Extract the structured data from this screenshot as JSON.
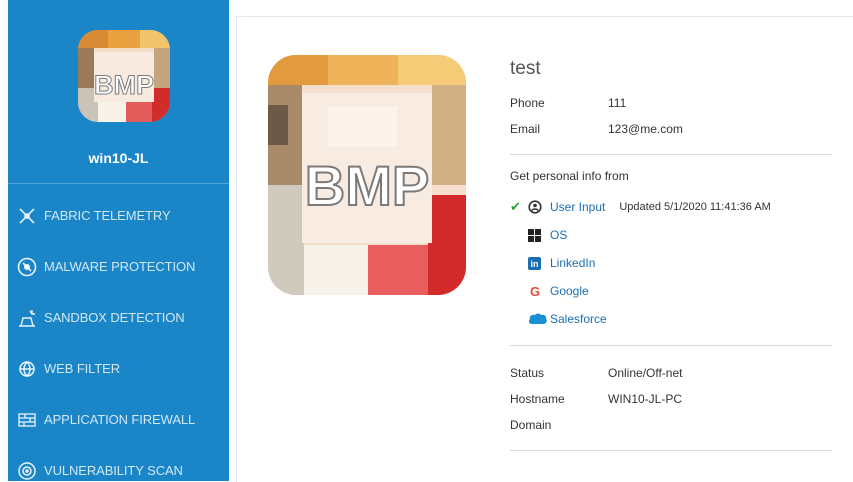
{
  "sidebar": {
    "avatar_text": "BMP",
    "device_name": "win10-JL",
    "nav": [
      {
        "label": "FABRIC TELEMETRY",
        "icon": "fabric-telemetry-icon"
      },
      {
        "label": "MALWARE PROTECTION",
        "icon": "malware-protection-icon"
      },
      {
        "label": "SANDBOX DETECTION",
        "icon": "sandbox-detection-icon"
      },
      {
        "label": "WEB FILTER",
        "icon": "web-filter-icon"
      },
      {
        "label": "APPLICATION FIREWALL",
        "icon": "application-firewall-icon"
      },
      {
        "label": "VULNERABILITY SCAN",
        "icon": "vulnerability-scan-icon"
      }
    ]
  },
  "profile": {
    "avatar_text": "BMP",
    "username": "test",
    "phone_label": "Phone",
    "phone_value": "111",
    "email_label": "Email",
    "email_value": "123@me.com",
    "sources_title": "Get personal info from",
    "sources": [
      {
        "label": "User Input",
        "icon": "user-icon",
        "checked": true,
        "updated": "Updated 5/1/2020 11:41:36 AM"
      },
      {
        "label": "OS",
        "icon": "windows-icon"
      },
      {
        "label": "LinkedIn",
        "icon": "linkedin-icon"
      },
      {
        "label": "Google",
        "icon": "google-icon"
      },
      {
        "label": "Salesforce",
        "icon": "salesforce-icon"
      }
    ],
    "status_label": "Status",
    "status_value": "Online/Off-net",
    "hostname_label": "Hostname",
    "hostname_value": "WIN10-JL-PC",
    "domain_label": "Domain",
    "domain_value": ""
  },
  "colors": {
    "sidebar_bg": "#1a86c8",
    "link": "#1a6fb5",
    "check": "#2ea13a"
  }
}
